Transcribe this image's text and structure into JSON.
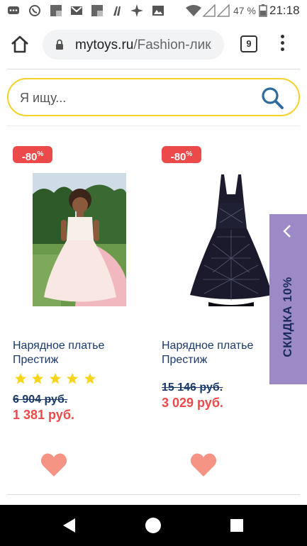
{
  "status_bar": {
    "battery": "47 %",
    "time": "21:18",
    "icons": [
      "chat-icon",
      "viber-icon",
      "app-icon",
      "gmail-icon",
      "app-icon",
      "l-icon",
      "sparkle-icon",
      "image-icon",
      "wifi-icon",
      "signal-icon",
      "signal-icon",
      "battery-icon"
    ]
  },
  "browser": {
    "url_host": "mytoys.ru",
    "url_path": "/Fashion-лик",
    "tab_count": "9"
  },
  "search": {
    "placeholder": "Я ищу..."
  },
  "products": [
    {
      "badge": "-80",
      "badge_suffix": "%",
      "title": "Нарядное платье Престиж",
      "rating": 5,
      "old_price": "6 904 руб.",
      "new_price": "1 381 руб."
    },
    {
      "badge": "-80",
      "badge_suffix": "%",
      "title": "Нарядное платье Престиж",
      "old_price": "15 146 руб.",
      "new_price": "3 029 руб."
    }
  ],
  "side_tab": {
    "label": "СКИДКА 10%"
  },
  "colors": {
    "accent_red": "#ec4a4a",
    "search_border": "#f5d12a",
    "title_blue": "#1a3a6b",
    "side_tab_bg": "#9c8ac7",
    "heart": "#f59484",
    "star": "#f7d51c"
  }
}
